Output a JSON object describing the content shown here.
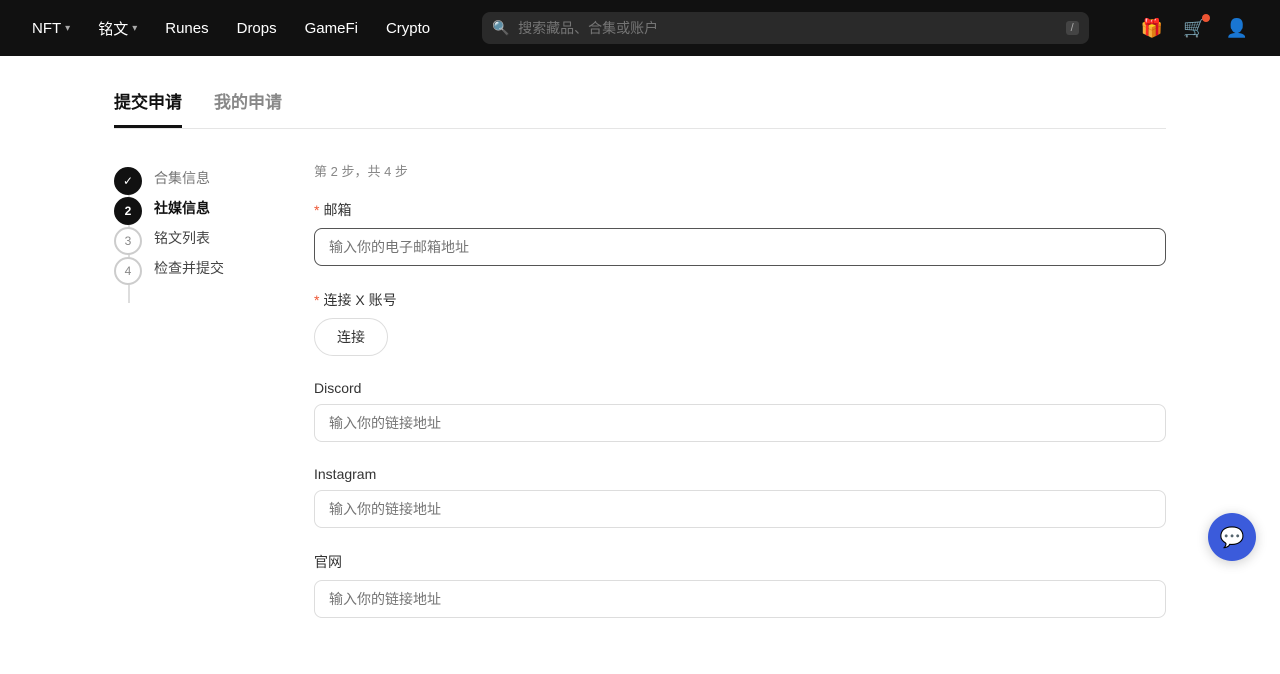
{
  "nav": {
    "items": [
      {
        "label": "NFT",
        "hasDropdown": true
      },
      {
        "label": "铭文",
        "hasDropdown": true
      },
      {
        "label": "Runes",
        "hasDropdown": false
      },
      {
        "label": "Drops",
        "hasDropdown": false
      },
      {
        "label": "GameFi",
        "hasDropdown": false
      },
      {
        "label": "Crypto",
        "hasDropdown": false
      }
    ],
    "search_placeholder": "搜索藏品、合集或账户",
    "search_shortcut": "/"
  },
  "tabs": [
    {
      "label": "提交申请",
      "active": true
    },
    {
      "label": "我的申请",
      "active": false
    }
  ],
  "stepper": {
    "steps": [
      {
        "number": "✓",
        "label": "合集信息",
        "state": "done"
      },
      {
        "number": "2",
        "label": "社媒信息",
        "state": "active"
      },
      {
        "number": "3",
        "label": "铭文列表",
        "state": "pending"
      },
      {
        "number": "4",
        "label": "检查并提交",
        "state": "pending"
      }
    ]
  },
  "form": {
    "step_info": "第 2 步，共 4 步",
    "fields": [
      {
        "id": "email",
        "label": "邮箱",
        "required": true,
        "placeholder": "输入你的电子邮箱地址",
        "type": "email",
        "is_connect": false
      },
      {
        "id": "x_account",
        "label": "连接 X 账号",
        "required": true,
        "placeholder": "",
        "type": "connect",
        "is_connect": true,
        "connect_btn_label": "连接"
      },
      {
        "id": "discord",
        "label": "Discord",
        "required": false,
        "placeholder": "输入你的链接地址",
        "type": "url",
        "is_connect": false
      },
      {
        "id": "instagram",
        "label": "Instagram",
        "required": false,
        "placeholder": "输入你的链接地址",
        "type": "url",
        "is_connect": false
      },
      {
        "id": "website",
        "label": "官网",
        "required": false,
        "placeholder": "输入你的链接地址",
        "type": "url",
        "is_connect": false
      }
    ]
  }
}
